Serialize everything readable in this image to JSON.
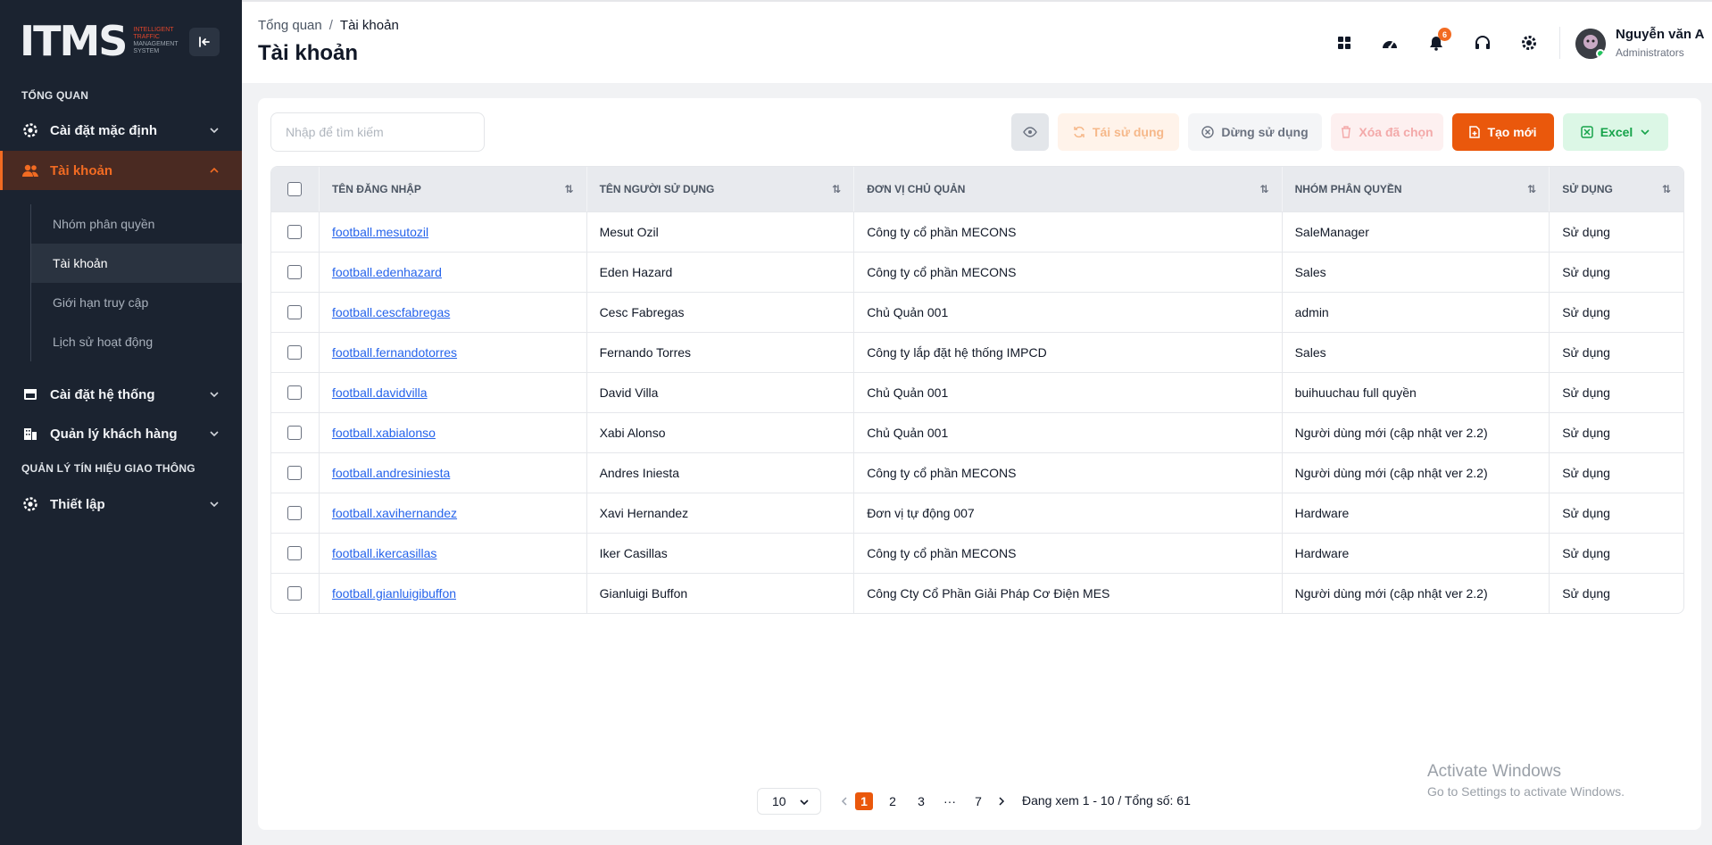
{
  "sidebar": {
    "logo_text": "ITMS",
    "logo_sub1": "INTELLIGENT",
    "logo_sub2": "TRAFFIC",
    "logo_sub3": "MANAGEMENT",
    "logo_sub4": "SYSTEM",
    "section_overview": "TỔNG QUAN",
    "default_settings": "Cài đặt mặc định",
    "accounts": "Tài khoản",
    "sub_items": [
      "Nhóm phân quyền",
      "Tài khoản",
      "Giới hạn truy cập",
      "Lịch sử hoạt động"
    ],
    "system_settings": "Cài đặt hệ thống",
    "customer_mgmt": "Quản lý khách hàng",
    "section_traffic": "QUẢN LÝ TÍN HIỆU GIAO THÔNG",
    "setup": "Thiết lập"
  },
  "header": {
    "breadcrumb_root": "Tổng quan",
    "breadcrumb_sep": "/",
    "breadcrumb_current": "Tài khoản",
    "title": "Tài khoản",
    "notification_count": "6",
    "user_name": "Nguyễn văn A",
    "user_role": "Administrators"
  },
  "toolbar": {
    "search_placeholder": "Nhập để tìm kiếm",
    "reuse_label": "Tái sử dụng",
    "stop_label": "Dừng sử dụng",
    "delete_label": "Xóa đã chọn",
    "create_label": "Tạo mới",
    "excel_label": "Excel"
  },
  "table": {
    "headers": [
      "TÊN ĐĂNG NHẬP",
      "TÊN NGƯỜI SỬ DỤNG",
      "ĐƠN VỊ CHỦ QUẢN",
      "NHÓM PHÂN QUYỀN",
      "SỬ DỤNG"
    ],
    "rows": [
      [
        "football.mesutozil",
        "Mesut Ozil",
        "Công ty cổ phần MECONS",
        "SaleManager",
        "Sử dụng"
      ],
      [
        "football.edenhazard",
        "Eden Hazard",
        "Công ty cổ phần MECONS",
        "Sales",
        "Sử dụng"
      ],
      [
        "football.cescfabregas",
        "Cesc Fabregas",
        "Chủ Quản 001",
        "admin",
        "Sử dụng"
      ],
      [
        "football.fernandotorres",
        "Fernando Torres",
        "Công ty lắp đặt hệ thống IMPCD",
        "Sales",
        "Sử dụng"
      ],
      [
        "football.davidvilla",
        "David Villa",
        "Chủ Quản 001",
        "buihuuchau full quyền",
        "Sử dụng"
      ],
      [
        "football.xabialonso",
        "Xabi Alonso",
        "Chủ Quản 001",
        "Người dùng mới (cập nhật ver 2.2)",
        "Sử dụng"
      ],
      [
        "football.andresiniesta",
        "Andres Iniesta",
        "Công ty cổ phần MECONS",
        "Người dùng mới (cập nhật ver 2.2)",
        "Sử dụng"
      ],
      [
        "football.xavihernandez",
        "Xavi Hernandez",
        "Đơn vị tự động 007",
        "Hardware",
        "Sử dụng"
      ],
      [
        "football.ikercasillas",
        "Iker Casillas",
        "Công ty cổ phần MECONS",
        "Hardware",
        "Sử dụng"
      ],
      [
        "football.gianluigibuffon",
        "Gianluigi Buffon",
        "Công Cty Cổ Phần Giải Pháp Cơ Điện MES",
        "Người dùng mới (cập nhật ver 2.2)",
        "Sử dụng"
      ]
    ]
  },
  "pagination": {
    "page_size": "10",
    "pages": [
      "1",
      "2",
      "3",
      "···",
      "7"
    ],
    "current": "1",
    "info": "Đang xem 1 - 10 / Tổng số: 61"
  },
  "watermark": {
    "line1": "Activate Windows",
    "line2": "Go to Settings to activate Windows."
  },
  "colors": {
    "accent": "#ea580c",
    "sidebar_bg": "#1b2330",
    "link": "#2563eb",
    "excel": "#16a34a"
  }
}
